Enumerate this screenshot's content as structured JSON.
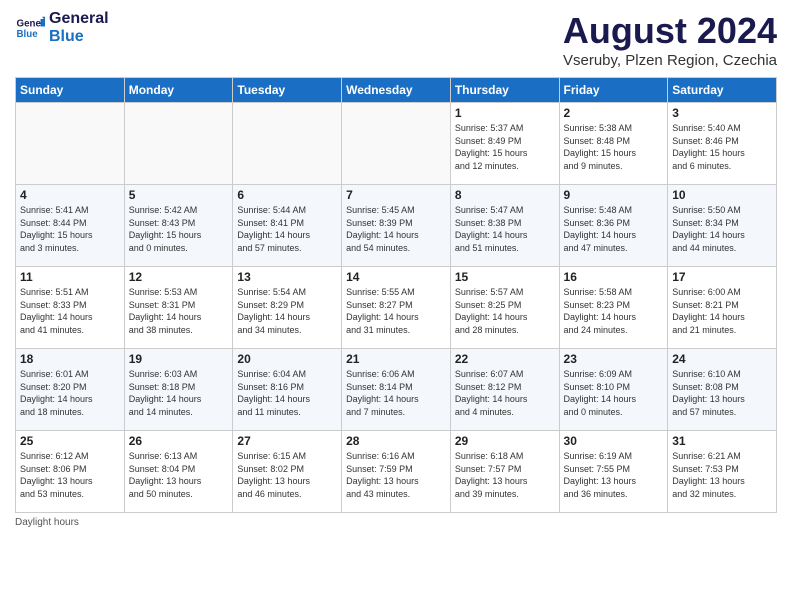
{
  "header": {
    "logo_line1": "General",
    "logo_line2": "Blue",
    "month_title": "August 2024",
    "location": "Vseruby, Plzen Region, Czechia"
  },
  "weekdays": [
    "Sunday",
    "Monday",
    "Tuesday",
    "Wednesday",
    "Thursday",
    "Friday",
    "Saturday"
  ],
  "weeks": [
    [
      {
        "day": "",
        "info": ""
      },
      {
        "day": "",
        "info": ""
      },
      {
        "day": "",
        "info": ""
      },
      {
        "day": "",
        "info": ""
      },
      {
        "day": "1",
        "info": "Sunrise: 5:37 AM\nSunset: 8:49 PM\nDaylight: 15 hours\nand 12 minutes."
      },
      {
        "day": "2",
        "info": "Sunrise: 5:38 AM\nSunset: 8:48 PM\nDaylight: 15 hours\nand 9 minutes."
      },
      {
        "day": "3",
        "info": "Sunrise: 5:40 AM\nSunset: 8:46 PM\nDaylight: 15 hours\nand 6 minutes."
      }
    ],
    [
      {
        "day": "4",
        "info": "Sunrise: 5:41 AM\nSunset: 8:44 PM\nDaylight: 15 hours\nand 3 minutes."
      },
      {
        "day": "5",
        "info": "Sunrise: 5:42 AM\nSunset: 8:43 PM\nDaylight: 15 hours\nand 0 minutes."
      },
      {
        "day": "6",
        "info": "Sunrise: 5:44 AM\nSunset: 8:41 PM\nDaylight: 14 hours\nand 57 minutes."
      },
      {
        "day": "7",
        "info": "Sunrise: 5:45 AM\nSunset: 8:39 PM\nDaylight: 14 hours\nand 54 minutes."
      },
      {
        "day": "8",
        "info": "Sunrise: 5:47 AM\nSunset: 8:38 PM\nDaylight: 14 hours\nand 51 minutes."
      },
      {
        "day": "9",
        "info": "Sunrise: 5:48 AM\nSunset: 8:36 PM\nDaylight: 14 hours\nand 47 minutes."
      },
      {
        "day": "10",
        "info": "Sunrise: 5:50 AM\nSunset: 8:34 PM\nDaylight: 14 hours\nand 44 minutes."
      }
    ],
    [
      {
        "day": "11",
        "info": "Sunrise: 5:51 AM\nSunset: 8:33 PM\nDaylight: 14 hours\nand 41 minutes."
      },
      {
        "day": "12",
        "info": "Sunrise: 5:53 AM\nSunset: 8:31 PM\nDaylight: 14 hours\nand 38 minutes."
      },
      {
        "day": "13",
        "info": "Sunrise: 5:54 AM\nSunset: 8:29 PM\nDaylight: 14 hours\nand 34 minutes."
      },
      {
        "day": "14",
        "info": "Sunrise: 5:55 AM\nSunset: 8:27 PM\nDaylight: 14 hours\nand 31 minutes."
      },
      {
        "day": "15",
        "info": "Sunrise: 5:57 AM\nSunset: 8:25 PM\nDaylight: 14 hours\nand 28 minutes."
      },
      {
        "day": "16",
        "info": "Sunrise: 5:58 AM\nSunset: 8:23 PM\nDaylight: 14 hours\nand 24 minutes."
      },
      {
        "day": "17",
        "info": "Sunrise: 6:00 AM\nSunset: 8:21 PM\nDaylight: 14 hours\nand 21 minutes."
      }
    ],
    [
      {
        "day": "18",
        "info": "Sunrise: 6:01 AM\nSunset: 8:20 PM\nDaylight: 14 hours\nand 18 minutes."
      },
      {
        "day": "19",
        "info": "Sunrise: 6:03 AM\nSunset: 8:18 PM\nDaylight: 14 hours\nand 14 minutes."
      },
      {
        "day": "20",
        "info": "Sunrise: 6:04 AM\nSunset: 8:16 PM\nDaylight: 14 hours\nand 11 minutes."
      },
      {
        "day": "21",
        "info": "Sunrise: 6:06 AM\nSunset: 8:14 PM\nDaylight: 14 hours\nand 7 minutes."
      },
      {
        "day": "22",
        "info": "Sunrise: 6:07 AM\nSunset: 8:12 PM\nDaylight: 14 hours\nand 4 minutes."
      },
      {
        "day": "23",
        "info": "Sunrise: 6:09 AM\nSunset: 8:10 PM\nDaylight: 14 hours\nand 0 minutes."
      },
      {
        "day": "24",
        "info": "Sunrise: 6:10 AM\nSunset: 8:08 PM\nDaylight: 13 hours\nand 57 minutes."
      }
    ],
    [
      {
        "day": "25",
        "info": "Sunrise: 6:12 AM\nSunset: 8:06 PM\nDaylight: 13 hours\nand 53 minutes."
      },
      {
        "day": "26",
        "info": "Sunrise: 6:13 AM\nSunset: 8:04 PM\nDaylight: 13 hours\nand 50 minutes."
      },
      {
        "day": "27",
        "info": "Sunrise: 6:15 AM\nSunset: 8:02 PM\nDaylight: 13 hours\nand 46 minutes."
      },
      {
        "day": "28",
        "info": "Sunrise: 6:16 AM\nSunset: 7:59 PM\nDaylight: 13 hours\nand 43 minutes."
      },
      {
        "day": "29",
        "info": "Sunrise: 6:18 AM\nSunset: 7:57 PM\nDaylight: 13 hours\nand 39 minutes."
      },
      {
        "day": "30",
        "info": "Sunrise: 6:19 AM\nSunset: 7:55 PM\nDaylight: 13 hours\nand 36 minutes."
      },
      {
        "day": "31",
        "info": "Sunrise: 6:21 AM\nSunset: 7:53 PM\nDaylight: 13 hours\nand 32 minutes."
      }
    ]
  ],
  "footer": "Daylight hours"
}
